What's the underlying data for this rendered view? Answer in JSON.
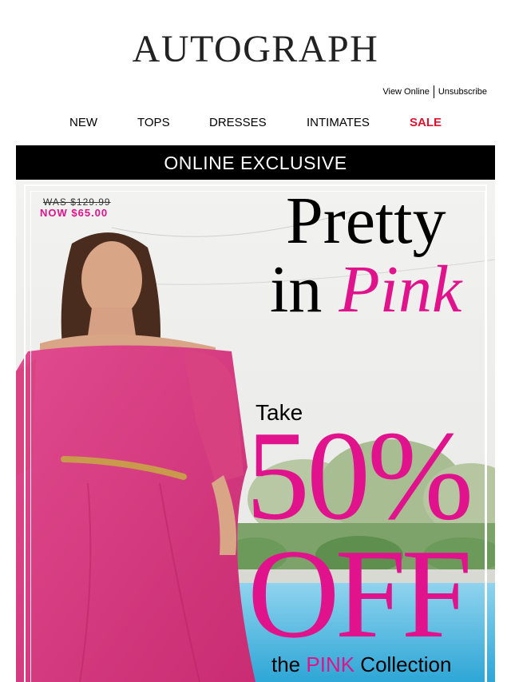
{
  "header": {
    "logo": "AUTOGRAPH",
    "view_online": "View Online",
    "unsubscribe": "Unsubscribe"
  },
  "nav": {
    "items": [
      "NEW",
      "TOPS",
      "DRESSES",
      "INTIMATES",
      "SALE"
    ]
  },
  "banner": {
    "text": "ONLINE EXCLUSIVE"
  },
  "hero": {
    "was_price": "WAS $129.99",
    "now_price": "NOW $65.00",
    "headline_line1": "Pretty",
    "headline_in": "in ",
    "headline_pink": "Pink",
    "take": "Take",
    "discount": "50%",
    "off": "OFF",
    "collection_prefix": "the ",
    "collection_pink": "PINK",
    "collection_suffix": " Collection"
  },
  "colors": {
    "accent_pink": "#e0138c",
    "sale_red": "#e0132f",
    "banner_bg": "#000000"
  }
}
